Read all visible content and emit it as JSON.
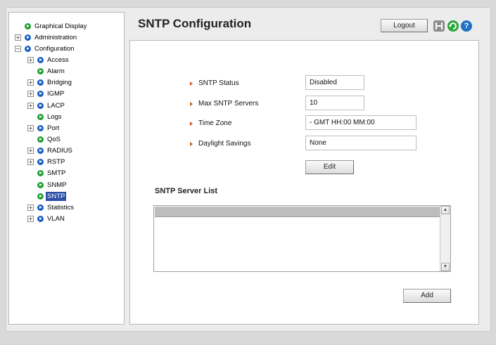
{
  "sidebar": {
    "items": [
      {
        "label": "Graphical Display",
        "expander": "",
        "icon": "green"
      },
      {
        "label": "Administration",
        "expander": "+",
        "icon": "blue"
      },
      {
        "label": "Configuration",
        "expander": "−",
        "icon": "blue"
      },
      {
        "label": "Access",
        "expander": "+",
        "icon": "blue"
      },
      {
        "label": "Alarm",
        "expander": "",
        "icon": "green"
      },
      {
        "label": "Bridging",
        "expander": "+",
        "icon": "blue"
      },
      {
        "label": "IGMP",
        "expander": "+",
        "icon": "blue"
      },
      {
        "label": "LACP",
        "expander": "+",
        "icon": "blue"
      },
      {
        "label": "Logs",
        "expander": "",
        "icon": "green"
      },
      {
        "label": "Port",
        "expander": "+",
        "icon": "blue"
      },
      {
        "label": "QoS",
        "expander": "",
        "icon": "green"
      },
      {
        "label": "RADIUS",
        "expander": "+",
        "icon": "blue"
      },
      {
        "label": "RSTP",
        "expander": "+",
        "icon": "blue"
      },
      {
        "label": "SMTP",
        "expander": "",
        "icon": "green"
      },
      {
        "label": "SNMP",
        "expander": "",
        "icon": "green"
      },
      {
        "label": "SNTP",
        "expander": "",
        "icon": "green",
        "selected": true
      },
      {
        "label": "Statistics",
        "expander": "+",
        "icon": "blue"
      },
      {
        "label": "VLAN",
        "expander": "+",
        "icon": "blue"
      }
    ]
  },
  "header": {
    "title": "SNTP Configuration",
    "logout_label": "Logout",
    "icons": [
      "save-icon",
      "refresh-icon",
      "help-icon"
    ],
    "help_glyph": "?"
  },
  "form": {
    "fields": [
      {
        "label": "SNTP Status",
        "value": "Disabled"
      },
      {
        "label": "Max SNTP Servers",
        "value": "10"
      },
      {
        "label": "Time Zone",
        "value": "- GMT HH:00 MM:00"
      },
      {
        "label": "Daylight Savings",
        "value": "None"
      }
    ],
    "edit_label": "Edit"
  },
  "server_list": {
    "title": "SNTP Server List",
    "add_label": "Add"
  },
  "colors": {
    "accent_blue": "#1a5fc2",
    "accent_green": "#1f9e2f",
    "bullet_orange": "#d2551c",
    "selection": "#2b4fa8"
  }
}
